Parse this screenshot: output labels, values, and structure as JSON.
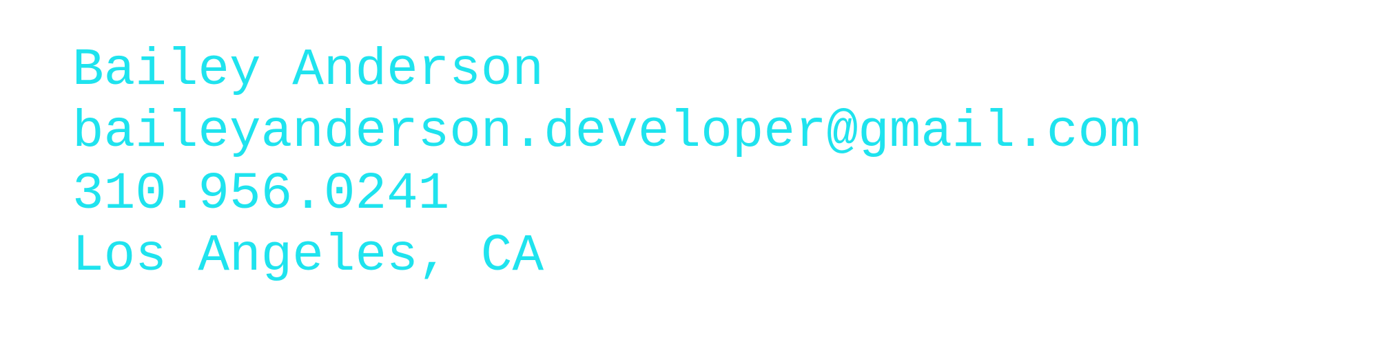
{
  "contact": {
    "name": "Bailey Anderson",
    "email": "baileyanderson.developer@gmail.com",
    "phone": "310.956.0241",
    "location": "Los Angeles, CA"
  },
  "colors": {
    "text": "#1fe3ee",
    "background": "#ffffff"
  }
}
